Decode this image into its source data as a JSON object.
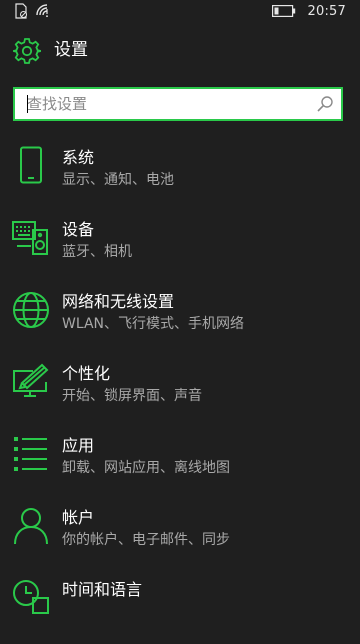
{
  "status_bar": {
    "time": "20:57"
  },
  "header": {
    "title": "设置"
  },
  "search": {
    "placeholder": "查找设置",
    "value": ""
  },
  "colors": {
    "accent": "#2ac94a",
    "background": "#1f1f1f",
    "secondary_text": "#a8a8a8"
  },
  "items": [
    {
      "label": "系统",
      "desc": "显示、通知、电池",
      "icon": "phone-icon"
    },
    {
      "label": "设备",
      "desc": "蓝牙、相机",
      "icon": "devices-icon"
    },
    {
      "label": "网络和无线设置",
      "desc": "WLAN、飞行模式、手机网络",
      "icon": "globe-icon"
    },
    {
      "label": "个性化",
      "desc": "开始、锁屏界面、声音",
      "icon": "personalization-icon"
    },
    {
      "label": "应用",
      "desc": "卸载、网站应用、离线地图",
      "icon": "apps-list-icon"
    },
    {
      "label": "帐户",
      "desc": "你的帐户、电子邮件、同步",
      "icon": "person-icon"
    },
    {
      "label": "时间和语言",
      "desc": "",
      "icon": "time-language-icon"
    }
  ]
}
